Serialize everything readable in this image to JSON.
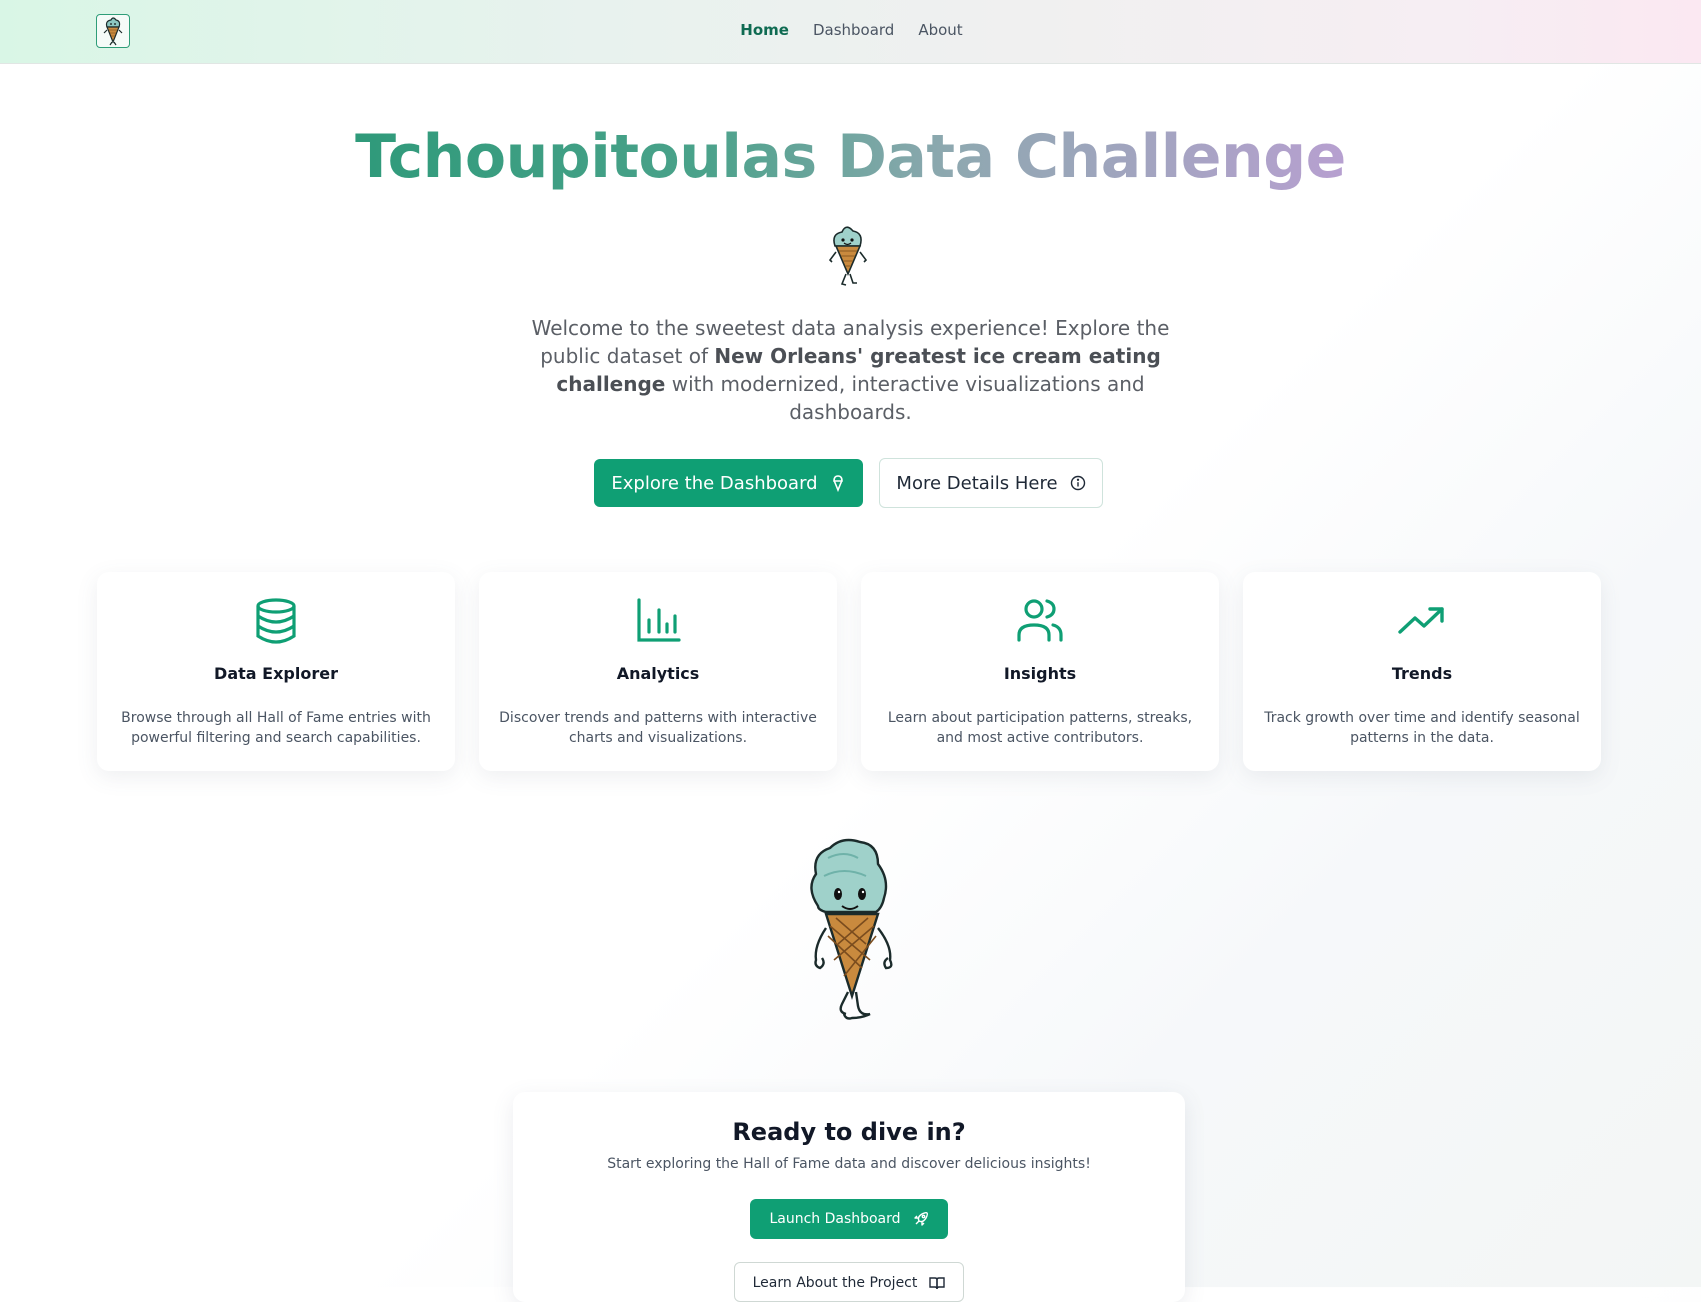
{
  "nav": {
    "logo_icon": "ice-cream-mascot-icon",
    "links": [
      {
        "label": "Home",
        "active": true
      },
      {
        "label": "Dashboard",
        "active": false
      },
      {
        "label": "About",
        "active": false
      }
    ]
  },
  "hero": {
    "title": "Tchoupitoulas Data Challenge",
    "mascot_icon": "ice-cream-mascot",
    "desc_part1": "Welcome to the sweetest data analysis experience! Explore the public dataset of ",
    "desc_bold": "New Orleans' greatest ice cream eating challenge",
    "desc_part2": " with modernized, interactive visualizations and dashboards.",
    "primary_button": "Explore the Dashboard",
    "primary_button_icon": "ice-cream-icon",
    "secondary_button": "More Details Here",
    "secondary_button_icon": "info-icon"
  },
  "features": [
    {
      "icon": "database-icon",
      "title": "Data Explorer",
      "desc": "Browse through all Hall of Fame entries with powerful filtering and search capabilities."
    },
    {
      "icon": "bar-chart-icon",
      "title": "Analytics",
      "desc": "Discover trends and patterns with interactive charts and visualizations."
    },
    {
      "icon": "users-icon",
      "title": "Insights",
      "desc": "Learn about participation patterns, streaks, and most active contributors."
    },
    {
      "icon": "trending-up-icon",
      "title": "Trends",
      "desc": "Track growth over time and identify seasonal patterns in the data."
    }
  ],
  "cta": {
    "title": "Ready to dive in?",
    "subtitle": "Start exploring the Hall of Fame data and discover delicious insights!",
    "primary_button": "Launch Dashboard",
    "primary_button_icon": "rocket-icon",
    "secondary_button": "Learn About the Project",
    "secondary_button_icon": "book-icon"
  },
  "colors": {
    "accent": "#0f9f74",
    "title_gradient_start": "#2f9a7a",
    "title_gradient_end": "#b7a0d0"
  }
}
